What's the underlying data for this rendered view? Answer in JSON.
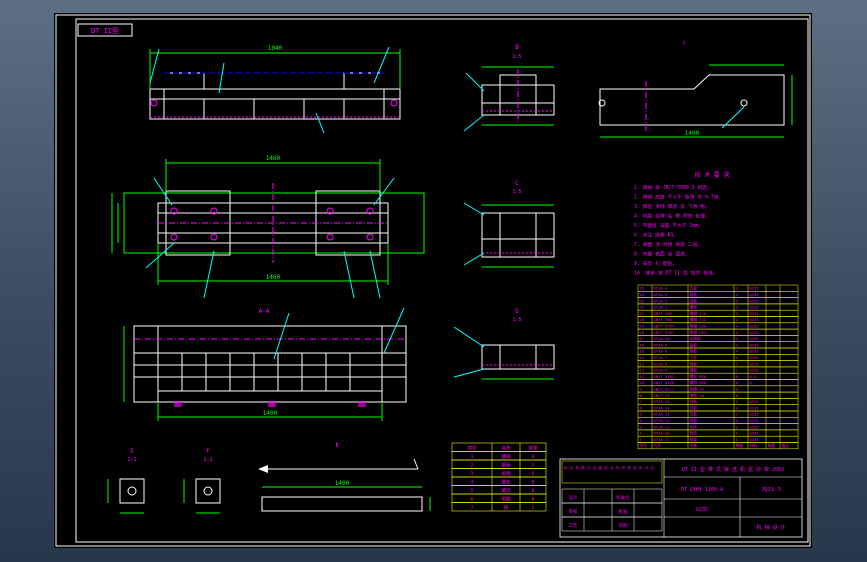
{
  "drawing": {
    "frame_tag": "DT II型",
    "colors": {
      "background": "#000000",
      "frame": "#ffffff",
      "outline": "#ffffff",
      "dimension": "#00ff00",
      "leader": "#00ffff",
      "text": "#ff00ff",
      "table_grid": "#ffff00",
      "hidden_line": "#0000ff",
      "weld_mark": "#ff00ff"
    },
    "views": {
      "front": {
        "dim_top": "1040"
      },
      "plan": {
        "dim_top": "1460",
        "dim_bottom": "1460"
      },
      "bottom": {
        "label": "A-A",
        "dim_bottom": "1400"
      },
      "side1": {
        "label": "B",
        "scale": "1:5"
      },
      "side2": {
        "label": "C",
        "scale": "1:5"
      },
      "side3": {
        "label": "D",
        "scale": "1:5"
      },
      "detail_plate": {
        "label": "Ⅰ",
        "dim": "1400"
      },
      "rail": {
        "label": "Ⅱ",
        "dim": "1400"
      },
      "small1": {
        "label": "E",
        "scale": "2:1"
      },
      "small2": {
        "label": "F",
        "scale": "2:1"
      }
    },
    "notes": {
      "title": "技 术 要 求",
      "lines": [
        "1. 焊接 按 JB/T 5000.3 规定。",
        "2. 焊缝 高度 不小于 板厚 的 0.7倍。",
        "3. 焊后 清除 焊渣 及 飞溅 物。",
        "4. 机架 组焊 后 需 时效 处理。",
        "5. 平面度 误差 不大于 2mm。",
        "6. 未注 圆角 R3。",
        "7. 表面 涂 防锈 底漆 二道。",
        "8. 外露 表面 涂 面漆。",
        "9. 安装 孔 配钻。",
        "10. 其余 按 DT II 型 技术 规范。"
      ]
    },
    "small_table": {
      "rows": [
        [
          "序号",
          "名称",
          "数量"
        ],
        [
          "1",
          "槽钢",
          "4"
        ],
        [
          "2",
          "钢板",
          "2"
        ],
        [
          "3",
          "角钢",
          "6"
        ],
        [
          "4",
          "螺栓",
          "8"
        ],
        [
          "5",
          "螺母",
          "8"
        ],
        [
          "6",
          "垫圈",
          "8"
        ],
        [
          "7",
          "销",
          "2"
        ]
      ]
    },
    "bom": {
      "rows": [
        [
          "25",
          "DT1A-4",
          "支座",
          "2",
          "Q235",
          "",
          ""
        ],
        [
          "24",
          "DT1A-3",
          "筋板",
          "4",
          "Q235",
          "",
          ""
        ],
        [
          "23",
          "DT1A-2",
          "底板",
          "2",
          "Q235",
          "",
          ""
        ],
        [
          "22",
          "DT1A-1",
          "横梁",
          "3",
          "Q235",
          "",
          ""
        ],
        [
          "21",
          "GB/T 706",
          "槽钢 [10",
          "2",
          "Q235",
          "",
          ""
        ],
        [
          "20",
          "GB/T 706",
          "槽钢 [12",
          "2",
          "Q235",
          "",
          ""
        ],
        [
          "19",
          "GB/T 9787",
          "角钢 L50",
          "4",
          "Q235",
          "",
          ""
        ],
        [
          "18",
          "GB/T 9787",
          "角钢 L63",
          "4",
          "Q235",
          "",
          ""
        ],
        [
          "17",
          "DT1A-10",
          "连接板",
          "6",
          "Q235",
          "",
          ""
        ],
        [
          "16",
          "DT1A-9",
          "盖板",
          "2",
          "Q235",
          "",
          ""
        ],
        [
          "15",
          "DT1A-8",
          "垫板",
          "4",
          "Q235",
          "",
          ""
        ],
        [
          "14",
          "DT1A-7",
          "立柱",
          "4",
          "Q235",
          "",
          ""
        ],
        [
          "13",
          "DT1A-6",
          "侧板",
          "2",
          "Q235",
          "",
          ""
        ],
        [
          "12",
          "DT1A-5",
          "端板",
          "2",
          "Q235",
          "",
          ""
        ],
        [
          "11",
          "GB/T 5782",
          "螺栓 M16",
          "8",
          "8.8",
          "",
          ""
        ],
        [
          "10",
          "GB/T 6170",
          "螺母 M16",
          "8",
          "8",
          "",
          ""
        ],
        [
          "9",
          "GB/T 97.1",
          "垫圈 16",
          "8",
          "",
          "",
          ""
        ],
        [
          "8",
          "GB/T 93",
          "弹垫 16",
          "8",
          "",
          "",
          ""
        ],
        [
          "7",
          "DT1A-15",
          "挡板",
          "2",
          "Q235",
          "",
          ""
        ],
        [
          "6",
          "DT1A-14",
          "托板",
          "4",
          "Q235",
          "",
          ""
        ],
        [
          "5",
          "DT1A-13",
          "支板",
          "2",
          "Q235",
          "",
          ""
        ],
        [
          "4",
          "DT1A-12",
          "耳板",
          "4",
          "Q235",
          "",
          ""
        ],
        [
          "3",
          "DT1A-11",
          "吊环",
          "2",
          "Q235",
          "",
          ""
        ],
        [
          "2",
          "DT1A-16",
          "导轨",
          "2",
          "Q235",
          "",
          ""
        ],
        [
          "1",
          "DT1A-17",
          "机架",
          "1",
          "Q235",
          "",
          ""
        ]
      ],
      "header": [
        "序号",
        "代号",
        "名称",
        "数量",
        "材料",
        "单重",
        "备注"
      ]
    },
    "title_block": {
      "main_title": "DT II 型 带 式 输 送 机 驱 动 架 2002",
      "drawing_no": "DT-CXHY 1200-4",
      "sheet_code": "JQ21-3",
      "material": "Q235",
      "company": "机 械 设 计",
      "notes_box": "标 记 处 数 分 区 更 改 文 件 号 签 名 年 月 日",
      "rows": [
        [
          "设计",
          "",
          "标准化",
          ""
        ],
        [
          "审核",
          "",
          "批准",
          ""
        ],
        [
          "工艺",
          "",
          "日期",
          ""
        ]
      ]
    }
  }
}
